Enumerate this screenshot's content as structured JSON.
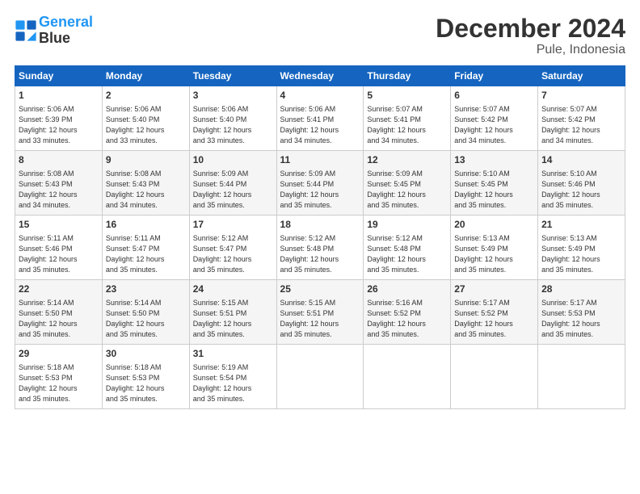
{
  "logo": {
    "line1": "General",
    "line2": "Blue"
  },
  "header": {
    "title": "December 2024",
    "subtitle": "Pule, Indonesia"
  },
  "weekdays": [
    "Sunday",
    "Monday",
    "Tuesday",
    "Wednesday",
    "Thursday",
    "Friday",
    "Saturday"
  ],
  "weeks": [
    [
      {
        "day": "1",
        "info": "Sunrise: 5:06 AM\nSunset: 5:39 PM\nDaylight: 12 hours\nand 33 minutes."
      },
      {
        "day": "2",
        "info": "Sunrise: 5:06 AM\nSunset: 5:40 PM\nDaylight: 12 hours\nand 33 minutes."
      },
      {
        "day": "3",
        "info": "Sunrise: 5:06 AM\nSunset: 5:40 PM\nDaylight: 12 hours\nand 33 minutes."
      },
      {
        "day": "4",
        "info": "Sunrise: 5:06 AM\nSunset: 5:41 PM\nDaylight: 12 hours\nand 34 minutes."
      },
      {
        "day": "5",
        "info": "Sunrise: 5:07 AM\nSunset: 5:41 PM\nDaylight: 12 hours\nand 34 minutes."
      },
      {
        "day": "6",
        "info": "Sunrise: 5:07 AM\nSunset: 5:42 PM\nDaylight: 12 hours\nand 34 minutes."
      },
      {
        "day": "7",
        "info": "Sunrise: 5:07 AM\nSunset: 5:42 PM\nDaylight: 12 hours\nand 34 minutes."
      }
    ],
    [
      {
        "day": "8",
        "info": "Sunrise: 5:08 AM\nSunset: 5:43 PM\nDaylight: 12 hours\nand 34 minutes."
      },
      {
        "day": "9",
        "info": "Sunrise: 5:08 AM\nSunset: 5:43 PM\nDaylight: 12 hours\nand 34 minutes."
      },
      {
        "day": "10",
        "info": "Sunrise: 5:09 AM\nSunset: 5:44 PM\nDaylight: 12 hours\nand 35 minutes."
      },
      {
        "day": "11",
        "info": "Sunrise: 5:09 AM\nSunset: 5:44 PM\nDaylight: 12 hours\nand 35 minutes."
      },
      {
        "day": "12",
        "info": "Sunrise: 5:09 AM\nSunset: 5:45 PM\nDaylight: 12 hours\nand 35 minutes."
      },
      {
        "day": "13",
        "info": "Sunrise: 5:10 AM\nSunset: 5:45 PM\nDaylight: 12 hours\nand 35 minutes."
      },
      {
        "day": "14",
        "info": "Sunrise: 5:10 AM\nSunset: 5:46 PM\nDaylight: 12 hours\nand 35 minutes."
      }
    ],
    [
      {
        "day": "15",
        "info": "Sunrise: 5:11 AM\nSunset: 5:46 PM\nDaylight: 12 hours\nand 35 minutes."
      },
      {
        "day": "16",
        "info": "Sunrise: 5:11 AM\nSunset: 5:47 PM\nDaylight: 12 hours\nand 35 minutes."
      },
      {
        "day": "17",
        "info": "Sunrise: 5:12 AM\nSunset: 5:47 PM\nDaylight: 12 hours\nand 35 minutes."
      },
      {
        "day": "18",
        "info": "Sunrise: 5:12 AM\nSunset: 5:48 PM\nDaylight: 12 hours\nand 35 minutes."
      },
      {
        "day": "19",
        "info": "Sunrise: 5:12 AM\nSunset: 5:48 PM\nDaylight: 12 hours\nand 35 minutes."
      },
      {
        "day": "20",
        "info": "Sunrise: 5:13 AM\nSunset: 5:49 PM\nDaylight: 12 hours\nand 35 minutes."
      },
      {
        "day": "21",
        "info": "Sunrise: 5:13 AM\nSunset: 5:49 PM\nDaylight: 12 hours\nand 35 minutes."
      }
    ],
    [
      {
        "day": "22",
        "info": "Sunrise: 5:14 AM\nSunset: 5:50 PM\nDaylight: 12 hours\nand 35 minutes."
      },
      {
        "day": "23",
        "info": "Sunrise: 5:14 AM\nSunset: 5:50 PM\nDaylight: 12 hours\nand 35 minutes."
      },
      {
        "day": "24",
        "info": "Sunrise: 5:15 AM\nSunset: 5:51 PM\nDaylight: 12 hours\nand 35 minutes."
      },
      {
        "day": "25",
        "info": "Sunrise: 5:15 AM\nSunset: 5:51 PM\nDaylight: 12 hours\nand 35 minutes."
      },
      {
        "day": "26",
        "info": "Sunrise: 5:16 AM\nSunset: 5:52 PM\nDaylight: 12 hours\nand 35 minutes."
      },
      {
        "day": "27",
        "info": "Sunrise: 5:17 AM\nSunset: 5:52 PM\nDaylight: 12 hours\nand 35 minutes."
      },
      {
        "day": "28",
        "info": "Sunrise: 5:17 AM\nSunset: 5:53 PM\nDaylight: 12 hours\nand 35 minutes."
      }
    ],
    [
      {
        "day": "29",
        "info": "Sunrise: 5:18 AM\nSunset: 5:53 PM\nDaylight: 12 hours\nand 35 minutes."
      },
      {
        "day": "30",
        "info": "Sunrise: 5:18 AM\nSunset: 5:53 PM\nDaylight: 12 hours\nand 35 minutes."
      },
      {
        "day": "31",
        "info": "Sunrise: 5:19 AM\nSunset: 5:54 PM\nDaylight: 12 hours\nand 35 minutes."
      },
      null,
      null,
      null,
      null
    ]
  ]
}
